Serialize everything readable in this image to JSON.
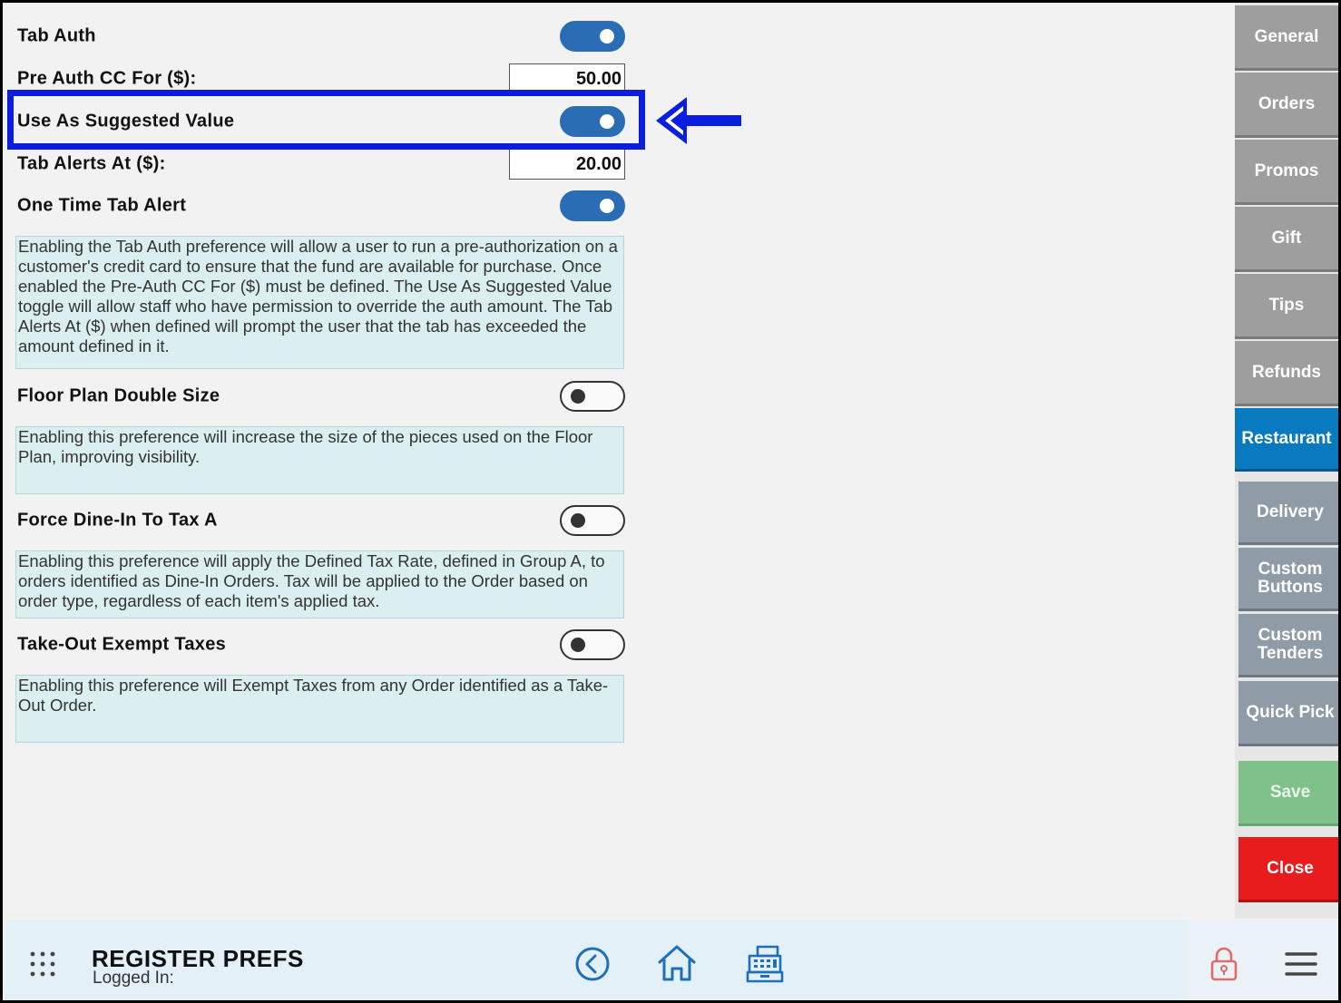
{
  "settings": {
    "tab_auth": {
      "label": "Tab Auth",
      "enabled": true
    },
    "pre_auth": {
      "label": "Pre Auth CC For ($):",
      "value": "50.00"
    },
    "use_suggested": {
      "label": "Use As Suggested Value",
      "enabled": true
    },
    "tab_alerts": {
      "label": "Tab Alerts At ($):",
      "value": "20.00"
    },
    "one_time_alert": {
      "label": "One Time Tab Alert",
      "enabled": true
    },
    "tab_auth_desc": "Enabling the Tab Auth preference will allow a user to run a pre-authorization on a customer's credit card to ensure that the fund are available for purchase. Once enabled the Pre-Auth CC For ($) must be defined. The Use As Suggested Value toggle will allow staff who have permission to override the auth amount. The Tab Alerts At ($) when defined will prompt the user that the tab has exceeded the amount defined in it.",
    "floor_plan": {
      "label": "Floor Plan Double Size",
      "enabled": false
    },
    "floor_plan_desc": "Enabling this preference will increase the size of the pieces used on the Floor Plan, improving visibility.",
    "force_dine_in": {
      "label": "Force Dine-In To Tax A",
      "enabled": false
    },
    "force_dine_in_desc": "Enabling this preference will apply the Defined Tax Rate, defined in Group A, to orders identified as Dine-In Orders. Tax will be applied to the Order based on order type, regardless of each item's applied tax.",
    "takeout_exempt": {
      "label": "Take-Out Exempt Taxes",
      "enabled": false
    },
    "takeout_exempt_desc": "Enabling this preference will Exempt Taxes from any Order identified as a Take-Out Order."
  },
  "sidebar": {
    "items": [
      {
        "label": "General"
      },
      {
        "label": "Orders"
      },
      {
        "label": "Promos"
      },
      {
        "label": "Gift"
      },
      {
        "label": "Tips"
      },
      {
        "label": "Refunds"
      },
      {
        "label": "Restaurant",
        "active": true
      },
      {
        "label": "Delivery"
      },
      {
        "label": "Custom Buttons"
      },
      {
        "label": "Custom Tenders"
      },
      {
        "label": "Quick Pick"
      }
    ],
    "save_label": "Save",
    "close_label": "Close"
  },
  "bottom_bar": {
    "title": "REGISTER PREFS",
    "status": "Logged In:",
    "icons": [
      "apps-grid-icon",
      "back-circle-icon",
      "home-icon",
      "cash-register-icon",
      "lock-icon",
      "hamburger-menu-icon"
    ]
  },
  "colors": {
    "toggle_on": "#2a6db5",
    "highlight": "#0a1ee0",
    "active_tab": "#0a7ac0",
    "save": "#7fc18a",
    "close": "#e81c1c",
    "description_bg": "#dbeef0"
  }
}
